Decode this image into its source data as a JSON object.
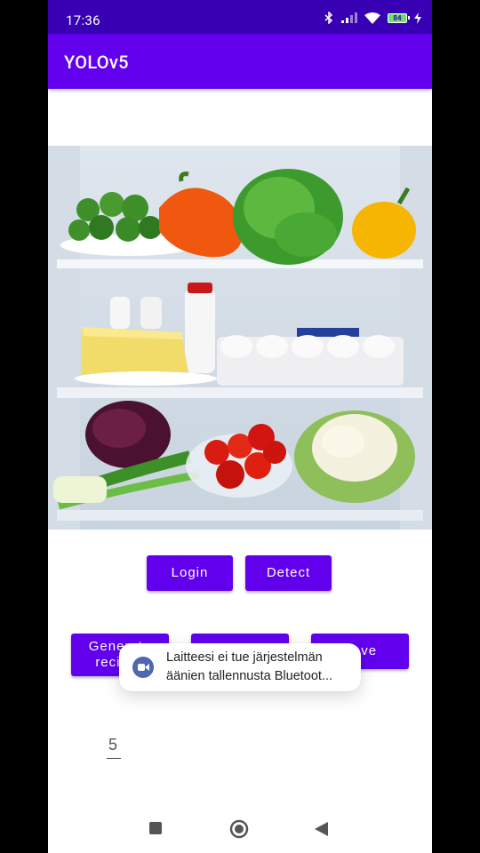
{
  "status_bar": {
    "time": "17:36",
    "battery": "84",
    "icons": [
      "bluetooth-icon",
      "signal-icon",
      "wifi-icon",
      "battery-icon",
      "charging-icon"
    ]
  },
  "app_bar": {
    "title": "YOLOv5"
  },
  "buttons": {
    "login": "Login",
    "detect": "Detect",
    "generate": "Generate recipes",
    "save": "Save"
  },
  "value_field": {
    "value": "5"
  },
  "toast": {
    "line1": "Laitteesi ei tue järjestelmän",
    "line2": "äänien tallennusta Bluetoot..."
  },
  "colors": {
    "status_bar": "#3700b3",
    "primary": "#6200ee"
  }
}
